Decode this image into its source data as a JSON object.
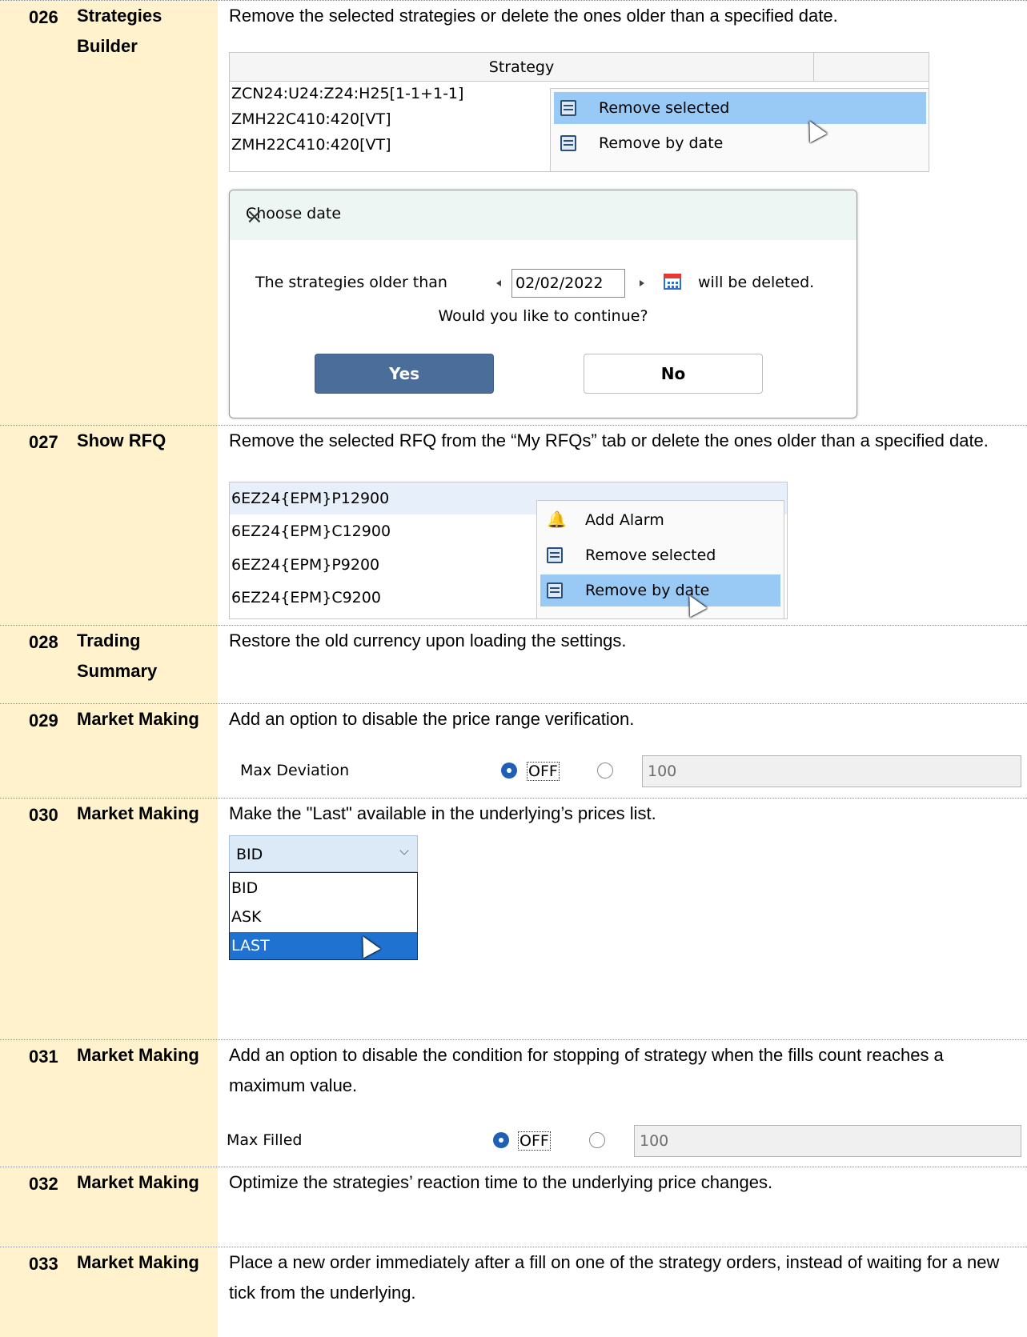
{
  "rows": {
    "r026": {
      "number": "026",
      "module": "Strategies Builder",
      "description": "Remove the selected strategies or delete the ones older than a specified date.",
      "grid_header": "Strategy",
      "grid_rows": [
        "ZCN24:U24:Z24:H25[1-1+1-1]",
        "ZMH22C410:420[VT]",
        "ZMH22C410:420[VT]"
      ],
      "menu_items": [
        "Remove selected",
        "Remove by date"
      ],
      "dialog": {
        "title": "Choose date",
        "close_glyph": "×",
        "text_before": "The strategies older than",
        "date_value": "02/02/2022",
        "text_after": "will be deleted.",
        "question": "Would you like to continue?",
        "yes_label": "Yes",
        "no_label": "No"
      }
    },
    "r027": {
      "number": "027",
      "module": "Show RFQ",
      "description": "Remove the selected RFQ from the “My RFQs” tab or delete the ones older than a specified date.",
      "grid_rows": [
        "6EZ24{EPM}P12900",
        "6EZ24{EPM}C12900",
        "6EZ24{EPM}P9200",
        "6EZ24{EPM}C9200"
      ],
      "menu_items": [
        "Add Alarm",
        "Remove selected",
        "Remove by date"
      ]
    },
    "r028": {
      "number": "028",
      "module": "Trading Summary",
      "description": "Restore the old currency upon loading the settings."
    },
    "r029": {
      "number": "029",
      "module": "Market Making",
      "description": "Add an option to disable the price range verification.",
      "field_label": "Max Deviation",
      "off_label": "OFF",
      "value": "100"
    },
    "r030": {
      "number": "030",
      "module": "Market Making",
      "description": "Make the \"Last\" available in the underlying’s prices list.",
      "selected": "BID",
      "options": [
        "BID",
        "ASK",
        "LAST"
      ]
    },
    "r031": {
      "number": "031",
      "module": "Market Making",
      "description": "Add an option to disable the condition for stopping of strategy when the fills count reaches a maximum value.",
      "field_label": "Max Filled",
      "off_label": "OFF",
      "value": "100"
    },
    "r032": {
      "number": "032",
      "module": "Market Making",
      "description": "Optimize the strategies’ reaction time to the underlying price changes."
    },
    "r033": {
      "number": "033",
      "module": "Market Making",
      "description": "Place a new order immediately after a fill on one of the strategy orders, instead of waiting for a new tick from the underlying."
    }
  },
  "icons": {
    "menu_item_icon": "list-remove-icon",
    "alarm_icon": "bell-icon",
    "calendar_icon": "calendar-icon",
    "cursor": "mouse-pointer-icon"
  },
  "colors": {
    "id_column_background": "#fff2cc",
    "menu_highlight": "#99c9f5",
    "yes_button": "#4a6d9a",
    "dropdown_selected": "#1f72d0",
    "radio_on": "#1f5fb4"
  }
}
